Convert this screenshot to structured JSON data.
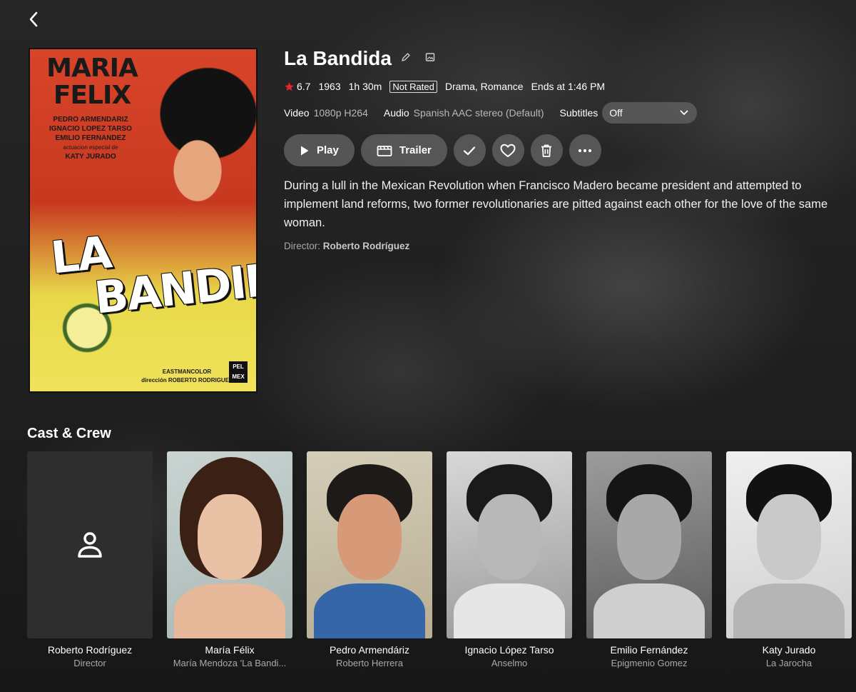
{
  "nav": {
    "back_icon": "chevron-left-icon"
  },
  "poster": {
    "name": "MARIA FELIX",
    "cast": [
      "PEDRO ARMENDARIZ",
      "IGNACIO LOPEZ TARSO",
      "EMILIO FERNANDEZ",
      "actuacion especial de",
      "KATY JURADO"
    ],
    "title_line1": "LA",
    "title_line2": "BANDIDA",
    "footer": [
      "EASTMANCOLOR",
      "dirección ROBERTO RODRIGUEZ"
    ],
    "logo": "PEL MEX"
  },
  "movie": {
    "title": "La Bandida",
    "rating": "6.7",
    "year": "1963",
    "runtime": "1h 30m",
    "content_rating": "Not Rated",
    "genres": "Drama, Romance",
    "ends_at": "Ends at 1:46 PM",
    "video_label": "Video",
    "video_value": "1080p H264",
    "audio_label": "Audio",
    "audio_value": "Spanish AAC stereo (Default)",
    "subtitles_label": "Subtitles",
    "subtitles_value": "Off",
    "overview": "During a lull in the Mexican Revolution when Francisco Madero became president and attempted to implement land reforms, two former revolutionaries are pitted against each other for the love of the same woman.",
    "director_label": "Director:",
    "director_name": "Roberto Rodríguez"
  },
  "actions": {
    "play": "Play",
    "trailer": "Trailer",
    "icons": [
      "play-icon",
      "film-icon",
      "check-icon",
      "heart-icon",
      "trash-icon",
      "more-icon"
    ]
  },
  "cast_section": {
    "title": "Cast & Crew",
    "members": [
      {
        "name": "Roberto Rodríguez",
        "role": "Director"
      },
      {
        "name": "María Félix",
        "role": "María Mendoza 'La Bandi..."
      },
      {
        "name": "Pedro Armendáriz",
        "role": "Roberto Herrera"
      },
      {
        "name": "Ignacio López Tarso",
        "role": "Anselmo"
      },
      {
        "name": "Emilio Fernández",
        "role": "Epigmenio Gomez"
      },
      {
        "name": "Katy Jurado",
        "role": "La Jarocha"
      }
    ]
  },
  "colors": {
    "star": "#e0262b",
    "button_bg": "#5a5a5a",
    "muted_text": "#a9a9a9"
  }
}
